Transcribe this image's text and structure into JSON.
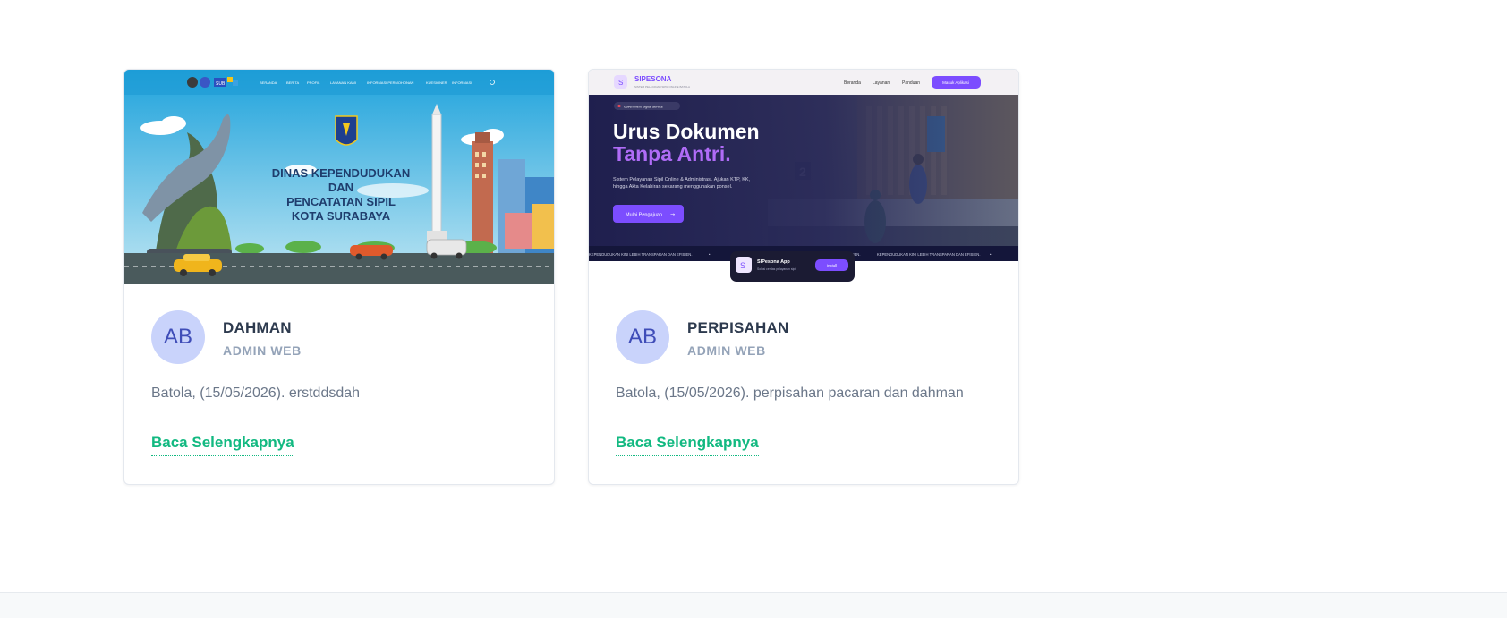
{
  "cards": [
    {
      "thumbnail": {
        "title_lines": [
          "DINAS KEPENDUDUKAN",
          "DAN",
          "PENCATATAN SIPIL",
          "KOTA SURABAYA"
        ],
        "nav_items": [
          "BERANDA",
          "BERITA",
          "PROFIL",
          "LAYANAN KAMI",
          "INFORMASI PERMOHONAN",
          "KUESIONER",
          "INFORMASI"
        ],
        "logo_text": "SUB"
      },
      "avatar_initials": "AB",
      "author_name": "DAHMAN",
      "author_role": "ADMIN WEB",
      "excerpt": "Batola, (15/05/2026). erstddsdah",
      "read_more": "Baca Selengkapnya"
    },
    {
      "thumbnail": {
        "brand": "SIPESONA",
        "brand_sub": "SISTEM PELAYANAN SIPIL ONLINE BATOLA",
        "nav_items": [
          "Beranda",
          "Layanan",
          "Panduan"
        ],
        "nav_cta": "Masuk Aplikasi",
        "badge": "Government Digital Service",
        "headline_1": "Urus Dokumen",
        "headline_2": "Tanpa Antri.",
        "subtext_1": "Sistem Pelayanan Sipil Online & Administrasi. Ajukan KTP, KK,",
        "subtext_2": "hingga Akta Kelahiran sekarang menggunakan ponsel.",
        "hero_button": "Mulai Pengajuan",
        "marquee": "KEPENDUDUKAN KINI LEBIH TRANSPARAN DAN EFISIEN.",
        "app_name": "SIPesona App",
        "app_sub": "Solusi cerdas pelayanan sipil",
        "app_button": "Install"
      },
      "avatar_initials": "AB",
      "author_name": "PERPISAHAN",
      "author_role": "ADMIN WEB",
      "excerpt": "Batola, (15/05/2026). perpisahan pacaran dan dahman",
      "read_more": "Baca Selengkapnya"
    }
  ],
  "colors": {
    "accent_green": "#12b981",
    "avatar_bg": "#c9d3fb",
    "avatar_text": "#3f4db8",
    "name_text": "#2d3a4e",
    "muted_text": "#94a3b8",
    "sipesona_purple": "#7c4dff"
  }
}
